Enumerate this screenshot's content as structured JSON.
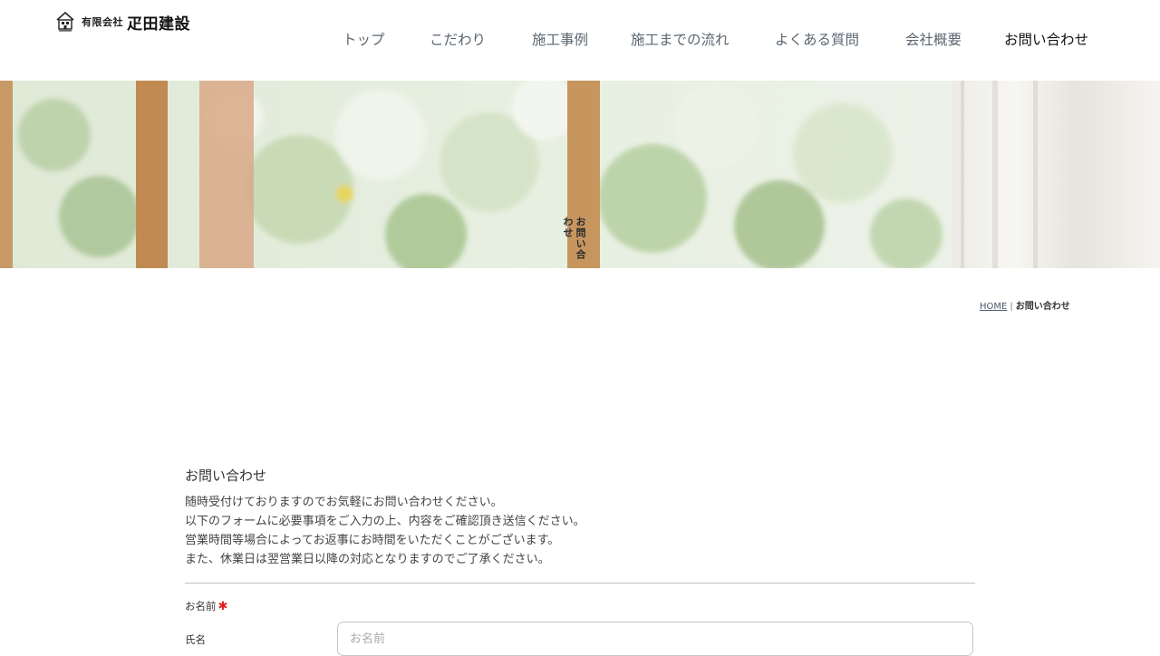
{
  "header": {
    "logo_small": "有限会社",
    "logo_big": "疋田建設",
    "nav": [
      {
        "label": "トップ"
      },
      {
        "label": "こだわり"
      },
      {
        "label": "施工事例"
      },
      {
        "label": "施工までの流れ"
      },
      {
        "label": "よくある質問"
      },
      {
        "label": "会社概要"
      },
      {
        "label": "お問い合わせ",
        "active": true
      }
    ]
  },
  "hero": {
    "title": "お問い合わせ"
  },
  "breadcrumb": {
    "home": "HOME",
    "separator": "|",
    "current": "お問い合わせ"
  },
  "main": {
    "title": "お問い合わせ",
    "intro": [
      "随時受付けておりますのでお気軽にお問い合わせください。",
      "以下のフォームに必要事項をご入力の上、内容をご確認頂き送信ください。",
      "営業時間等場合によってお返事にお時間をいただくことがございます。",
      "また、休業日は翌営業日以降の対応となりますのでご了承ください。"
    ]
  },
  "form": {
    "name_label": "お名前",
    "required_mark": "✱",
    "name_sublabel": "氏名",
    "name_placeholder": "お名前",
    "name_value": ""
  },
  "colors": {
    "nav_text": "#5b6670",
    "nav_active": "#111111",
    "required": "#e02020"
  }
}
